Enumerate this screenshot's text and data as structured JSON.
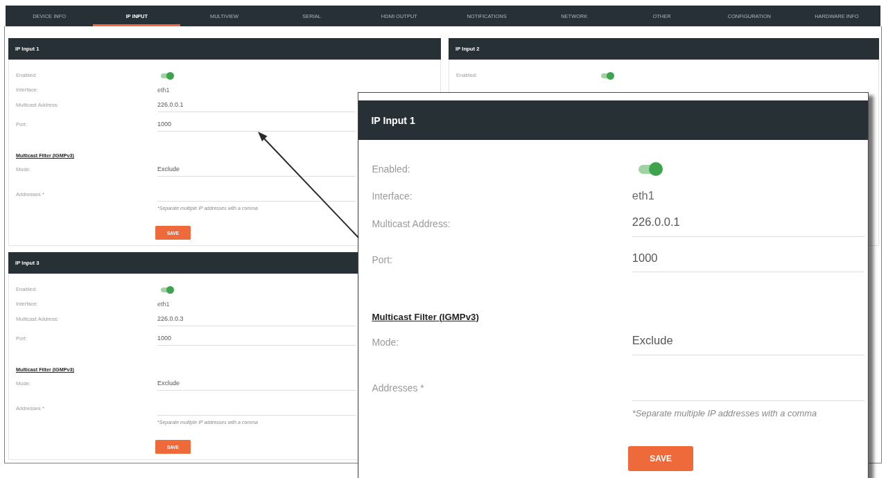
{
  "nav_tabs": [
    {
      "label": "DEVICE INFO",
      "selected": false
    },
    {
      "label": "IP INPUT",
      "selected": true
    },
    {
      "label": "MULTIVIEW",
      "selected": false
    },
    {
      "label": "SERIAL",
      "selected": false
    },
    {
      "label": "HDMI OUTPUT",
      "selected": false
    },
    {
      "label": "NOTIFICATIONS",
      "selected": false
    },
    {
      "label": "NETWORK",
      "selected": false
    },
    {
      "label": "OTHER",
      "selected": false
    },
    {
      "label": "CONFIGURATION",
      "selected": false
    },
    {
      "label": "HARDWARE INFO",
      "selected": false
    }
  ],
  "panels": [
    {
      "title": "IP Input 1",
      "settings": [
        {
          "kind": "toggle",
          "label": "Enabled:",
          "on": true
        },
        {
          "kind": "text",
          "label": "Interface:",
          "value": "eth1"
        },
        {
          "kind": "field",
          "label": "Multicast Address:",
          "value": "226.0.0.1"
        },
        {
          "kind": "field",
          "label": "Port:",
          "value": "1000"
        }
      ],
      "filter": {
        "heading": "Multicast Filter (IGMPv3)",
        "settings": [
          {
            "kind": "field",
            "label": "Mode:",
            "value": "Exclude"
          },
          {
            "kind": "field",
            "label": "Addresses *"
          }
        ],
        "note": "*Separate multiple IP addresses with a comma"
      },
      "save_button": "SAVE"
    },
    {
      "title": "IP Input 2",
      "settings": [
        {
          "kind": "toggle",
          "label": "Enabled:",
          "on": true
        }
      ]
    },
    {
      "title": "IP Input 3",
      "settings": [
        {
          "kind": "toggle",
          "label": "Enabled:",
          "on": true
        },
        {
          "kind": "text",
          "label": "Interface:",
          "value": "eth1"
        },
        {
          "kind": "field",
          "label": "Multicast Address:",
          "value": "226.0.0.3"
        },
        {
          "kind": "field",
          "label": "Port:",
          "value": "1000"
        }
      ],
      "filter": {
        "heading": "Multicast Filter (IGMPv3)",
        "settings": [
          {
            "kind": "field",
            "label": "Mode:",
            "value": "Exclude"
          },
          {
            "kind": "field",
            "label": "Addresses *"
          }
        ],
        "note": "*Separate multiple IP addresses with a comma"
      },
      "save_button": "SAVE"
    }
  ],
  "zoom_callout": {
    "title": "IP Input 1",
    "settings": [
      {
        "kind": "toggle",
        "label": "Enabled:",
        "on": true
      },
      {
        "kind": "text",
        "label": "Interface:",
        "value": "eth1"
      },
      {
        "kind": "field",
        "label": "Multicast Address:",
        "value": "226.0.0.1"
      },
      {
        "kind": "field",
        "label": "Port:",
        "value": "1000"
      }
    ],
    "filter": {
      "heading": "Multicast Filter (IGMPv3)",
      "settings": [
        {
          "kind": "field",
          "label": "Mode:",
          "value": "Exclude"
        },
        {
          "kind": "field",
          "label": "Addresses *"
        }
      ],
      "note": "*Separate multiple IP addresses with a comma"
    },
    "save_button": "SAVE"
  }
}
